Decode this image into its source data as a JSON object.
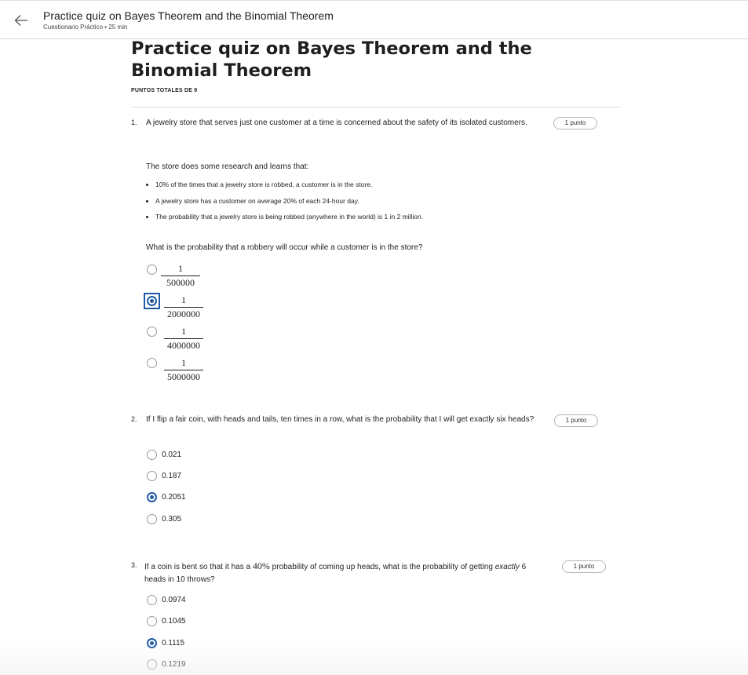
{
  "header": {
    "title": "Practice quiz on Bayes Theorem and the Binomial Theorem",
    "meta": "Cuestionario Práctico • 25 min"
  },
  "quiz": {
    "title": "Practice quiz on Bayes Theorem and the Binomial Theorem",
    "total_points": "PUNTOS TOTALES DE 9"
  },
  "questions": [
    {
      "number": "1.",
      "text": "A jewelry store that serves just one customer at a time is concerned about the safety of its isolated customers.",
      "points": "1 punto",
      "intro": "The store does some research and learns that:",
      "bullets": [
        "10% of the times that a jewelry store is robbed, a customer is in the store.",
        "A jewelry store has a customer on average 20% of each 24-hour day.",
        "The probability that a jewelry store is being robbed (anywhere in the world) is 1 in 2 million."
      ],
      "prompt": "What is the probability that a robbery will occur while a customer is in the store?",
      "options": [
        {
          "num": "1",
          "den": "500000"
        },
        {
          "num": "1",
          "den": "2000000"
        },
        {
          "num": "1",
          "den": "4000000"
        },
        {
          "num": "1",
          "den": "5000000"
        }
      ],
      "selected_option": "1/2000000"
    },
    {
      "number": "2.",
      "text": "If I flip a fair coin, with heads and tails, ten times in a row, what is the probability that I will get exactly six heads?",
      "points": "1 punto",
      "options": [
        "0.021",
        "0.187",
        "0.2051",
        "0.305"
      ],
      "selected_option": "0.2051"
    },
    {
      "number": "3.",
      "text_before": "If a coin is bent so that it has a ",
      "text_math": "40%",
      "text_after": " probability of coming up heads, what is the probability of getting ",
      "text_em": "exactly",
      "text_end": " 6 heads in 10 throws?",
      "points": "1 punto",
      "options": [
        "0.0974",
        "0.1045",
        "0.1115",
        "0.1219"
      ],
      "selected_option": "0.1115"
    }
  ],
  "colors": {
    "accent": "#1f5aa8",
    "text": "#1f1f1f",
    "border": "#d8d8d8"
  },
  "icons": {
    "back": "arrow-left-icon"
  }
}
